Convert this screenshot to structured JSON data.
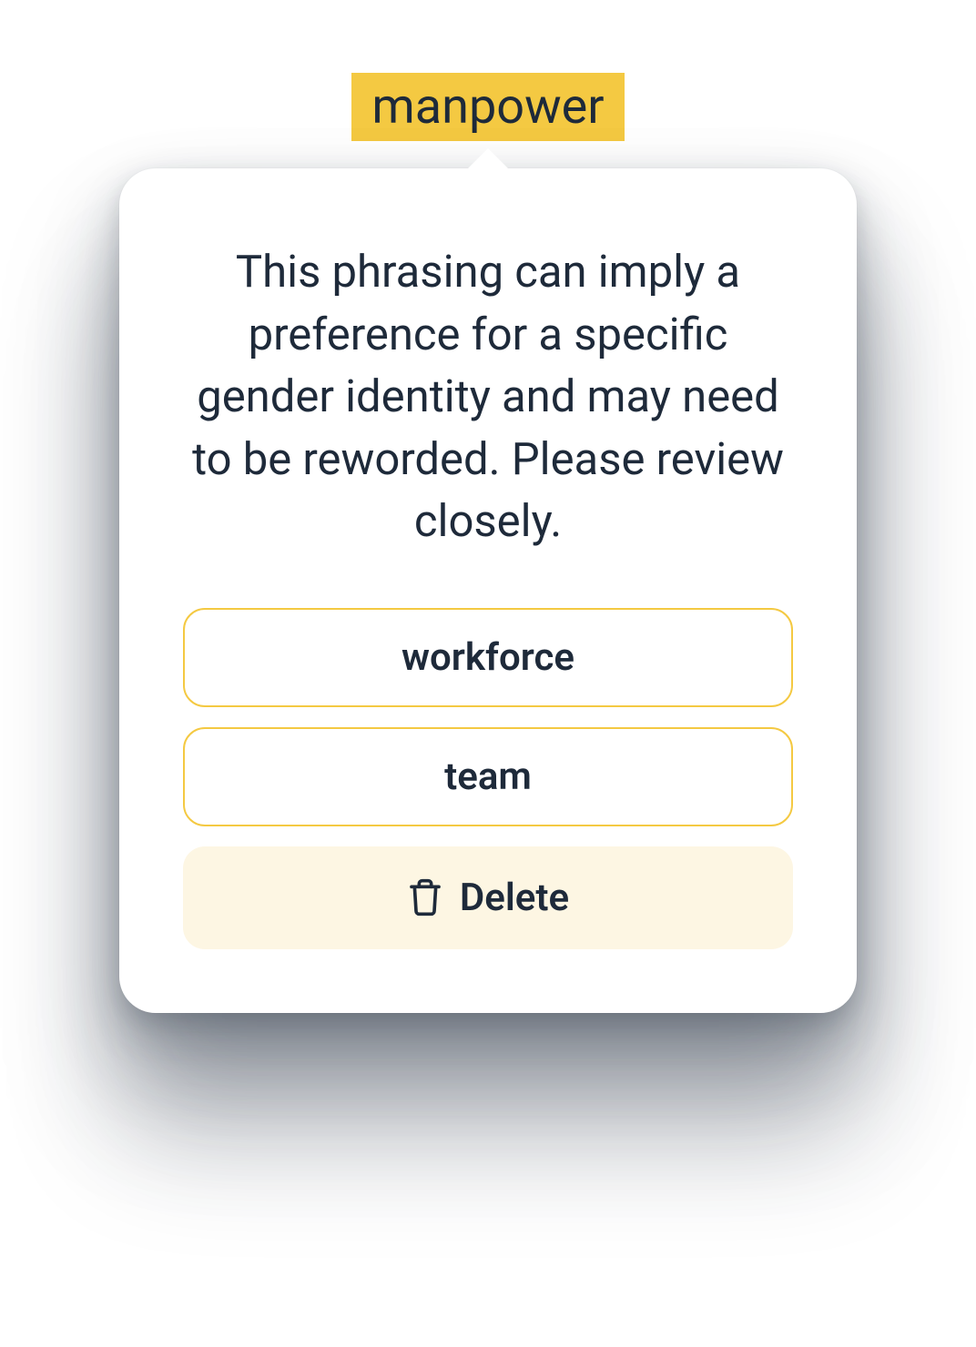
{
  "highlight": {
    "word": "manpower"
  },
  "tooltip": {
    "description": "This phrasing can imply a preference for a specific gender identity and may need to be reworded. Please review closely.",
    "suggestions": [
      {
        "label": "workforce"
      },
      {
        "label": "team"
      }
    ],
    "delete_label": "Delete"
  },
  "colors": {
    "highlight_bg": "#f4c942",
    "text_dark": "#1e2a3a",
    "delete_bg": "#fdf6e3",
    "border_yellow": "#f4c942"
  }
}
